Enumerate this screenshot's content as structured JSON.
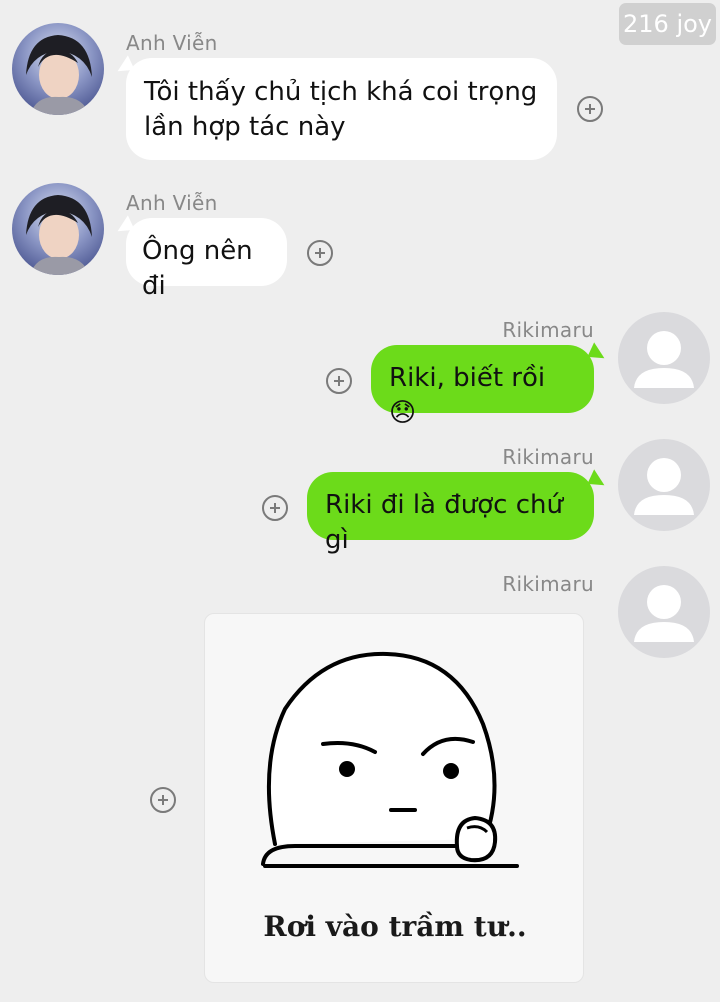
{
  "watermark": "216 joy",
  "messages": [
    {
      "sender": "Anh Viễn",
      "side": "left",
      "line1": "Tôi thấy chủ tịch khá coi trọng",
      "line2": "lần hợp tác này"
    },
    {
      "sender": "Anh Viễn",
      "side": "left",
      "text": "Ông nên đi"
    },
    {
      "sender": "Rikimaru",
      "side": "right",
      "text": "Riki, biết rồi",
      "emoji": "😞"
    },
    {
      "sender": "Rikimaru",
      "side": "right",
      "text": "Riki đi là được chứ gì"
    },
    {
      "sender": "Rikimaru",
      "side": "right",
      "sticker_caption": "Rơi vào trầm tư.."
    }
  ],
  "icons": {
    "plus": "plus-circle-icon",
    "default_avatar": "default-user-avatar-icon"
  },
  "colors": {
    "background": "#eeeeee",
    "bubble_in": "#ffffff",
    "bubble_out": "#6cdb1a",
    "sender_name": "#888888"
  }
}
